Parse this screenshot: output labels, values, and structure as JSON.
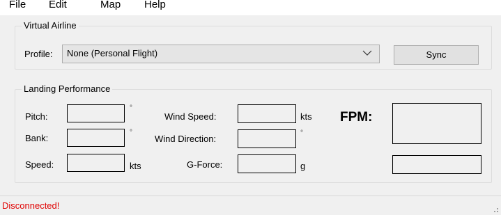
{
  "menu": {
    "items": [
      "File",
      "Edit",
      "Map",
      "Help"
    ]
  },
  "virtual_airline": {
    "group_title": "Virtual Airline",
    "profile_label": "Profile:",
    "profile_value": "None (Personal Flight)",
    "sync_label": "Sync"
  },
  "landing": {
    "group_title": "Landing Performance",
    "pitch_label": "Pitch:",
    "bank_label": "Bank:",
    "speed_label": "Speed:",
    "wind_speed_label": "Wind Speed:",
    "wind_direction_label": "Wind Direction:",
    "gforce_label": "G-Force:",
    "fpm_label": "FPM:",
    "pitch_value": "",
    "bank_value": "",
    "speed_value": "",
    "wind_speed_value": "",
    "wind_direction_value": "",
    "gforce_value": "",
    "fpm_value": "",
    "fpm_secondary_value": "",
    "degree_unit": "°",
    "kts_unit": "kts",
    "g_unit": "g"
  },
  "status": {
    "text": "Disconnected!",
    "color": "#e00000"
  }
}
